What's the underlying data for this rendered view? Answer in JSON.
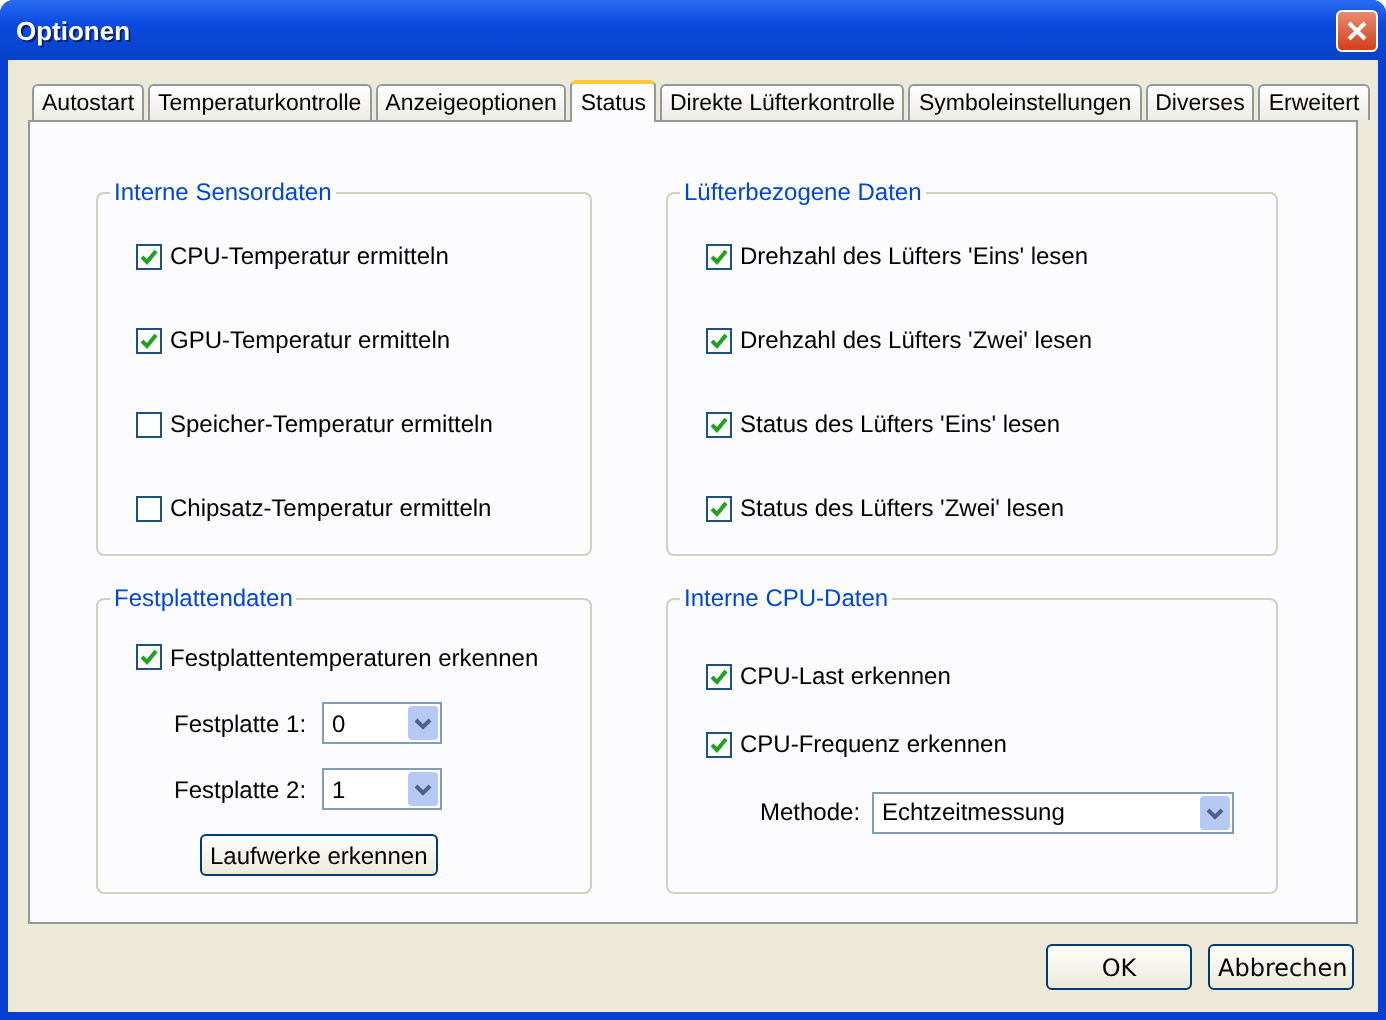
{
  "window": {
    "title": "Optionen"
  },
  "tabs": [
    {
      "label": "Autostart",
      "selected": false
    },
    {
      "label": "Temperaturkontrolle",
      "selected": false
    },
    {
      "label": "Anzeigeoptionen",
      "selected": false
    },
    {
      "label": "Status",
      "selected": true
    },
    {
      "label": "Direkte Lüfterkontrolle",
      "selected": false
    },
    {
      "label": "Symboleinstellungen",
      "selected": false
    },
    {
      "label": "Diverses",
      "selected": false
    },
    {
      "label": "Erweitert",
      "selected": false
    }
  ],
  "groups": [
    {
      "title": "Interne Sensordaten",
      "items": [
        {
          "kind": "checkbox",
          "label": "CPU-Temperatur ermitteln",
          "checked": true
        },
        {
          "kind": "checkbox",
          "label": "GPU-Temperatur ermitteln",
          "checked": true
        },
        {
          "kind": "checkbox",
          "label": "Speicher-Temperatur ermitteln",
          "checked": false
        },
        {
          "kind": "checkbox",
          "label": "Chipsatz-Temperatur ermitteln",
          "checked": false
        }
      ]
    },
    {
      "title": "Lüfterbezogene Daten",
      "items": [
        {
          "kind": "checkbox",
          "label": "Drehzahl des Lüfters 'Eins' lesen",
          "checked": true
        },
        {
          "kind": "checkbox",
          "label": "Drehzahl des Lüfters 'Zwei' lesen",
          "checked": true
        },
        {
          "kind": "checkbox",
          "label": "Status des Lüfters 'Eins' lesen",
          "checked": true
        },
        {
          "kind": "checkbox",
          "label": "Status des Lüfters 'Zwei' lesen",
          "checked": true
        }
      ]
    },
    {
      "title": "Festplattendaten",
      "items": [
        {
          "kind": "checkbox",
          "label": "Festplattentemperaturen erkennen",
          "checked": true
        },
        {
          "kind": "select",
          "label": "Festplatte 1:",
          "value": "0"
        },
        {
          "kind": "select",
          "label": "Festplatte 2:",
          "value": "1"
        },
        {
          "kind": "button",
          "label": "Laufwerke erkennen"
        }
      ]
    },
    {
      "title": "Interne CPU-Daten",
      "items": [
        {
          "kind": "checkbox",
          "label": "CPU-Last erkennen",
          "checked": true
        },
        {
          "kind": "checkbox",
          "label": "CPU-Frequenz erkennen",
          "checked": true
        },
        {
          "kind": "select",
          "label": "Methode:",
          "value": "Echtzeitmessung"
        }
      ]
    }
  ],
  "buttons": [
    "OK",
    "Abbrechen"
  ]
}
